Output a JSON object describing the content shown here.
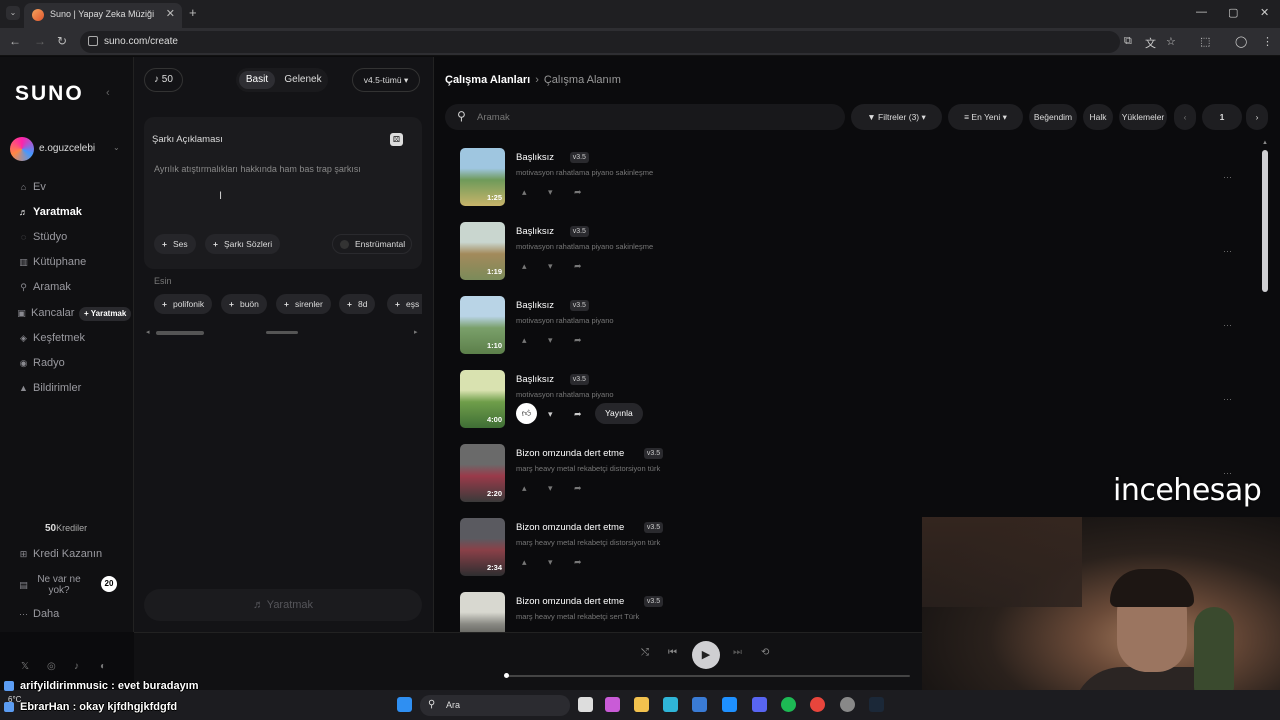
{
  "browser": {
    "tab_title": "Suno | Yapay Zeka Müziği",
    "tab_close": "✕",
    "new_tab": "+",
    "url": "suno.com/create",
    "window_controls": [
      "—",
      "▢",
      "✕"
    ]
  },
  "sidebar": {
    "logo": "SUNO",
    "username": "e.oguzcelebi",
    "nav": [
      {
        "label": "Ev",
        "icon": "home-icon",
        "glyph": "⌂"
      },
      {
        "label": "Yaratmak",
        "icon": "music-note-icon",
        "glyph": "♬"
      },
      {
        "label": "Stüdyo",
        "icon": "studio-icon",
        "glyph": "◌"
      },
      {
        "label": "Kütüphane",
        "icon": "library-icon",
        "glyph": "▥"
      },
      {
        "label": "Aramak",
        "icon": "search-icon",
        "glyph": "⚲"
      },
      {
        "label": "Kancalar",
        "icon": "hooks-icon",
        "glyph": "▣"
      },
      {
        "label": "Keşfetmek",
        "icon": "explore-icon",
        "glyph": "◈"
      },
      {
        "label": "Radyo",
        "icon": "radio-icon",
        "glyph": "◉"
      },
      {
        "label": "Bildirimler",
        "icon": "bell-icon",
        "glyph": "▲"
      }
    ],
    "hooks_badge": "+ Yaratmak",
    "credits_value": "50",
    "credits_label": "Krediler",
    "earn_credits": "Kredi Kazanın",
    "whats_new": "Ne var ne yok?",
    "whats_new_count": "20",
    "more": "Daha"
  },
  "create": {
    "credits": "50",
    "mode_simple": "Basit",
    "mode_custom": "Gelenek",
    "version": "v4.5-tümü",
    "desc_title": "Şarkı Açıklaması",
    "desc_placeholder": "Ayrılık atıştırmalıkları hakkında ham bas trap şarkısı",
    "chips": [
      "Ses",
      "Şarkı Sözleri"
    ],
    "instrumental": "Enstrümantal",
    "inspiration_label": "Esin",
    "inspiration_chips": [
      "polifonik",
      "buön",
      "sirenler",
      "8d",
      "eşs"
    ],
    "create_button": "Yaratmak"
  },
  "workspace": {
    "breadcrumb_root": "Çalışma Alanları",
    "breadcrumb_current": "Çalışma Alanım",
    "search_placeholder": "Aramak",
    "filters": "Filtreler",
    "filter_count": "(3)",
    "sort": "En Yeni",
    "liked": "Beğendim",
    "public": "Halk",
    "uploads": "Yüklemeler",
    "page": "1"
  },
  "songs": [
    {
      "title": "Başlıksız",
      "version": "v3.5",
      "desc": "motivasyon rahatlama piyano sakinleşme",
      "duration": "1:25",
      "palette": [
        "#9fc6e0",
        "#6f9a5a",
        "#c8b46a"
      ]
    },
    {
      "title": "Başlıksız",
      "version": "v3.5",
      "desc": "motivasyon rahatlama piyano sakinleşme",
      "duration": "1:19",
      "palette": [
        "#c9d6cf",
        "#a38a5b",
        "#7b8b5a"
      ]
    },
    {
      "title": "Başlıksız",
      "version": "v3.5",
      "desc": "motivasyon rahatlama piyano",
      "duration": "1:10",
      "palette": [
        "#b9d4e6",
        "#7aa06a",
        "#5c7f4a"
      ]
    },
    {
      "title": "Başlıksız",
      "version": "v3.5",
      "desc": "motivasyon rahatlama piyano",
      "duration": "4:00",
      "palette": [
        "#d9e2b0",
        "#6f9e4a",
        "#3f6e35"
      ],
      "liked": true,
      "publish": "Yayınla"
    },
    {
      "title": "Bizon omzunda dert etme",
      "version": "v3.5",
      "desc": "marş heavy metal rekabetçi distorsiyon türk",
      "duration": "2:20",
      "palette": [
        "#6a6a6a",
        "#9a3a4a",
        "#3a3a3a"
      ]
    },
    {
      "title": "Bizon omzunda dert etme",
      "version": "v3.5",
      "desc": "marş heavy metal rekabetçi distorsiyon türk",
      "duration": "2:34",
      "palette": [
        "#5a5a60",
        "#8a4048",
        "#2e2e30"
      ]
    },
    {
      "title": "Bizon omzunda dert etme",
      "version": "v3.5",
      "desc": "marş heavy metal rekabetçi sert Türk",
      "duration": "",
      "palette": [
        "#d8d8d0",
        "#8a8a84",
        "#2a2a28"
      ]
    }
  ],
  "overlay": {
    "watermark": "incehesap",
    "chat": [
      {
        "user": "arifyildirimmusic",
        "message": " : evet buradayım"
      },
      {
        "user": "EbrarHan",
        "message": " : okay kjfdhgjkfdgfd"
      }
    ],
    "weather": "6°C"
  },
  "taskbar": {
    "search": "Ara"
  },
  "player": {
    "progress": 0
  }
}
